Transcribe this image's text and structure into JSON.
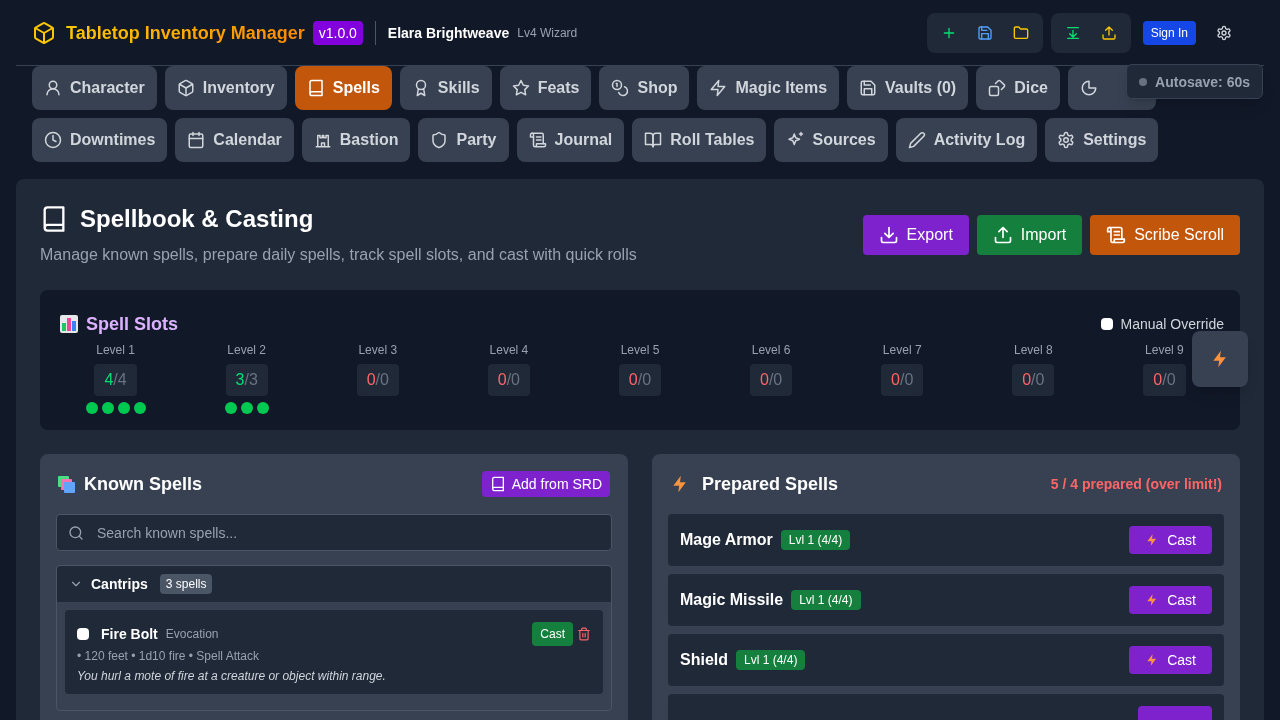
{
  "app": {
    "title": "Tabletop Inventory Manager",
    "version": "v1.0.0"
  },
  "character": {
    "name": "Elara Brightweave",
    "subtitle": "Lv4 Wizard"
  },
  "toolbar": {
    "sign_in": "Sign In"
  },
  "autosave": {
    "label": "Autosave: 60s",
    "active": false
  },
  "tab_rows": [
    [
      {
        "label": "Character",
        "selected": false
      },
      {
        "label": "Inventory",
        "selected": false
      },
      {
        "label": "Spells",
        "selected": true
      },
      {
        "label": "Skills",
        "selected": false
      },
      {
        "label": "Feats",
        "selected": false
      },
      {
        "label": "Shop",
        "selected": false
      },
      {
        "label": "Magic Items",
        "selected": false
      },
      {
        "label": "Vaults (0)",
        "selected": false
      },
      {
        "label": "Dice",
        "selected": false
      },
      {
        "selected": false
      }
    ],
    [
      {
        "label": "Downtimes",
        "selected": false
      },
      {
        "label": "Calendar",
        "selected": false
      },
      {
        "label": "Bastion",
        "selected": false
      },
      {
        "label": "Party",
        "selected": false
      },
      {
        "label": "Journal",
        "selected": false
      },
      {
        "label": "Roll Tables",
        "selected": false
      },
      {
        "label": "Sources",
        "selected": false
      },
      {
        "label": "Activity Log",
        "selected": false
      },
      {
        "label": "Settings",
        "selected": false
      }
    ]
  ],
  "page": {
    "title": "Spellbook & Casting",
    "subtitle": "Manage known spells, prepare daily spells, track spell slots, and cast with quick rolls",
    "actions": [
      {
        "label": "Export",
        "kind": "export"
      },
      {
        "label": "Import",
        "kind": "import"
      },
      {
        "label": "Scribe Scroll",
        "kind": "scroll"
      }
    ]
  },
  "spell_slots": {
    "title": "Spell Slots",
    "manual_override": {
      "label": "Manual Override",
      "checked": false
    },
    "levels": [
      {
        "label": "Level 1",
        "current": "4",
        "max": "/4"
      },
      {
        "label": "Level 2",
        "current": "3",
        "max": "/3"
      },
      {
        "label": "Level 3",
        "current": "0",
        "max": "/0"
      },
      {
        "label": "Level 4",
        "current": "0",
        "max": "/0"
      },
      {
        "label": "Level 5",
        "current": "0",
        "max": "/0"
      },
      {
        "label": "Level 6",
        "current": "0",
        "max": "/0"
      },
      {
        "label": "Level 7",
        "current": "0",
        "max": "/0"
      },
      {
        "label": "Level 8",
        "current": "0",
        "max": "/0"
      },
      {
        "label": "Level 9",
        "current": "0",
        "max": "/0"
      }
    ]
  },
  "known_spells": {
    "title": "Known Spells",
    "add_button": "Add from SRD",
    "search": {
      "placeholder": "Search known spells..."
    },
    "groups": [
      {
        "title": "Cantrips",
        "count": "3 spells",
        "expanded": true,
        "spells": [
          {
            "name": "Fire Bolt",
            "school": "Evocation",
            "details": "• 120 feet • 1d10 fire • Spell Attack",
            "description": "You hurl a mote of fire at a creature or object within range.",
            "prepared": false,
            "cast": "Cast"
          }
        ]
      }
    ]
  },
  "prepared_spells": {
    "title": "Prepared Spells",
    "status": "5 / 4 prepared (over limit!)",
    "over_limit": true,
    "spells": [
      {
        "name": "Mage Armor",
        "slot": "Lvl 1 (4/4)",
        "cast": "Cast"
      },
      {
        "name": "Magic Missile",
        "slot": "Lvl 1 (4/4)",
        "cast": "Cast"
      },
      {
        "name": "Shield",
        "slot": "Lvl 1 (4/4)",
        "cast": "Cast"
      }
    ]
  }
}
